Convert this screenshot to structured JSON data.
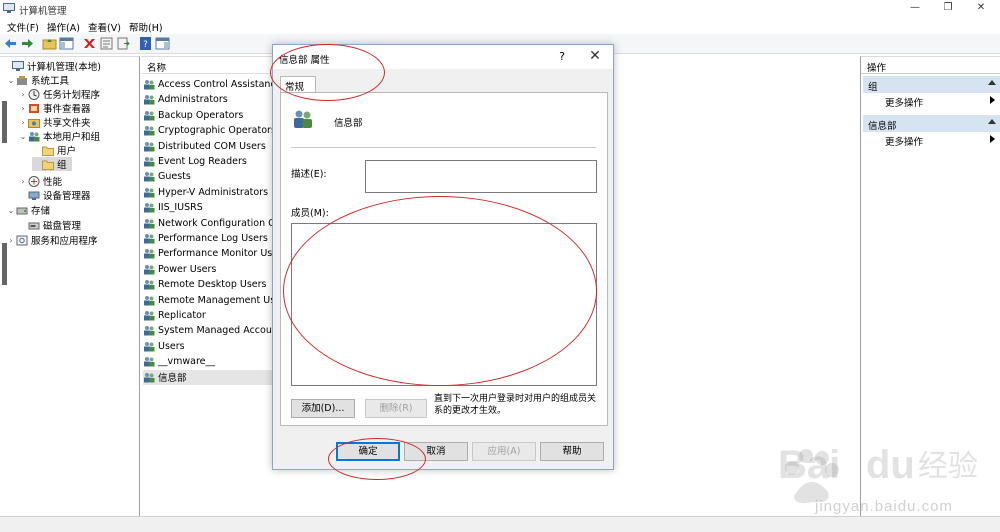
{
  "window": {
    "title": "计算机管理",
    "controls": [
      "—",
      "❐",
      "✕"
    ]
  },
  "menu": [
    "文件(F)",
    "操作(A)",
    "查看(V)",
    "帮助(H)"
  ],
  "tree": [
    {
      "label": "计算机管理(本地)",
      "level": 0,
      "twisty": "",
      "icon": "computer-management-icon"
    },
    {
      "label": "系统工具",
      "level": 1,
      "twisty": "⌄",
      "icon": "system-tools-icon"
    },
    {
      "label": "任务计划程序",
      "level": 2,
      "twisty": "›",
      "icon": "task-scheduler-icon"
    },
    {
      "label": "事件查看器",
      "level": 2,
      "twisty": "›",
      "icon": "event-viewer-icon"
    },
    {
      "label": "共享文件夹",
      "level": 2,
      "twisty": "›",
      "icon": "shared-folders-icon"
    },
    {
      "label": "本地用户和组",
      "level": 2,
      "twisty": "⌄",
      "icon": "local-users-groups-icon"
    },
    {
      "label": "用户",
      "level": 3,
      "twisty": "",
      "icon": "folder-icon"
    },
    {
      "label": "组",
      "level": 3,
      "twisty": "",
      "icon": "folder-icon",
      "selected": true
    },
    {
      "label": "性能",
      "level": 2,
      "twisty": "›",
      "icon": "performance-icon"
    },
    {
      "label": "设备管理器",
      "level": 2,
      "twisty": "",
      "icon": "device-manager-icon"
    },
    {
      "label": "存储",
      "level": 1,
      "twisty": "⌄",
      "icon": "storage-icon"
    },
    {
      "label": "磁盘管理",
      "level": 2,
      "twisty": "",
      "icon": "disk-management-icon"
    },
    {
      "label": "服务和应用程序",
      "level": 1,
      "twisty": "›",
      "icon": "services-apps-icon"
    }
  ],
  "list": {
    "header": "名称",
    "items": [
      "Access Control Assistance",
      "Administrators",
      "Backup Operators",
      "Cryptographic Operators",
      "Distributed COM Users",
      "Event Log Readers",
      "Guests",
      "Hyper-V Administrators",
      "IIS_IUSRS",
      "Network Configuration Op",
      "Performance Log Users",
      "Performance Monitor User",
      "Power Users",
      "Remote Desktop Users",
      "Remote Management User",
      "Replicator",
      "System Managed Accounts",
      "Users",
      "__vmware__",
      "信息部"
    ],
    "selected_index": 19
  },
  "actions": {
    "title": "操作",
    "sections": [
      {
        "label": "组",
        "item": "更多操作"
      },
      {
        "label": "信息部",
        "item": "更多操作"
      }
    ]
  },
  "dialog": {
    "title": "信息部 属性",
    "help_glyph": "?",
    "close_glyph": "✕",
    "tab": "常规",
    "group_name": "信息部",
    "description_label": "描述(E):",
    "description_value": "",
    "members_label": "成员(M):",
    "add_button": "添加(D)...",
    "remove_button": "删除(R)",
    "note": "直到下一次用户登录时对用户的组成员关系的更改才生效。",
    "ok_button": "确定",
    "cancel_button": "取消",
    "apply_button": "应用(A)",
    "help_button": "帮助"
  },
  "watermark": {
    "text": "jingyan.baidu.com"
  },
  "colors": {
    "selection": "#d9d9d9",
    "action_section": "#d6e4f2",
    "annotation_red": "#d02b2b",
    "default_button_border": "#0078d7"
  }
}
